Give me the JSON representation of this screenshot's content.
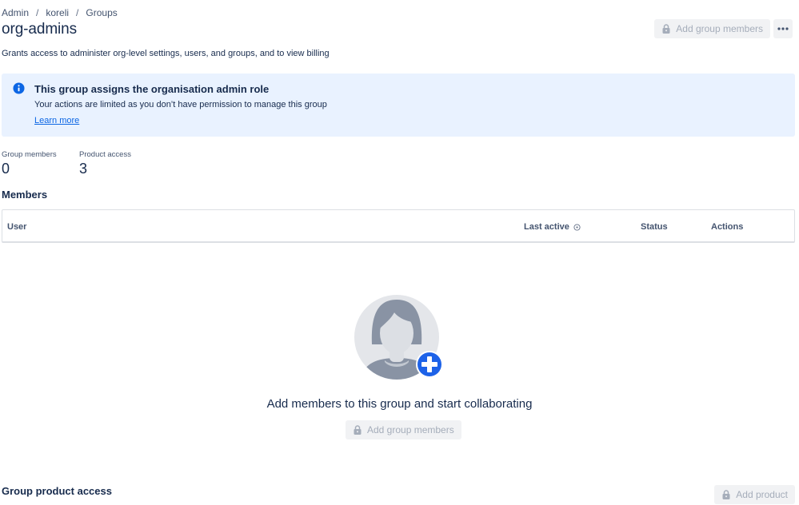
{
  "breadcrumb": {
    "items": [
      "Admin",
      "koreli",
      "Groups"
    ],
    "separator": "/"
  },
  "page": {
    "title": "org-admins",
    "description": "Grants access to administer org-level settings, users, and groups, and to view billing"
  },
  "header_actions": {
    "add_members_label": "Add group members",
    "more_icon": "more-horizontal-icon"
  },
  "banner": {
    "title": "This group assigns the organisation admin role",
    "text": "Your actions are limited as you don’t have permission to manage this group",
    "link": "Learn more",
    "icon": "info-icon",
    "background": "#e9f2ff",
    "icon_color": "#0c66e4"
  },
  "stats": [
    {
      "label": "Group members",
      "value": "0"
    },
    {
      "label": "Product access",
      "value": "3"
    }
  ],
  "members": {
    "title": "Members",
    "columns": {
      "user": "User",
      "last_active": "Last active",
      "status": "Status",
      "actions": "Actions"
    }
  },
  "empty_state": {
    "message": "Add members to this group and start collaborating",
    "button_label": "Add group members"
  },
  "product_access": {
    "title": "Group product access",
    "button_label": "Add product"
  }
}
